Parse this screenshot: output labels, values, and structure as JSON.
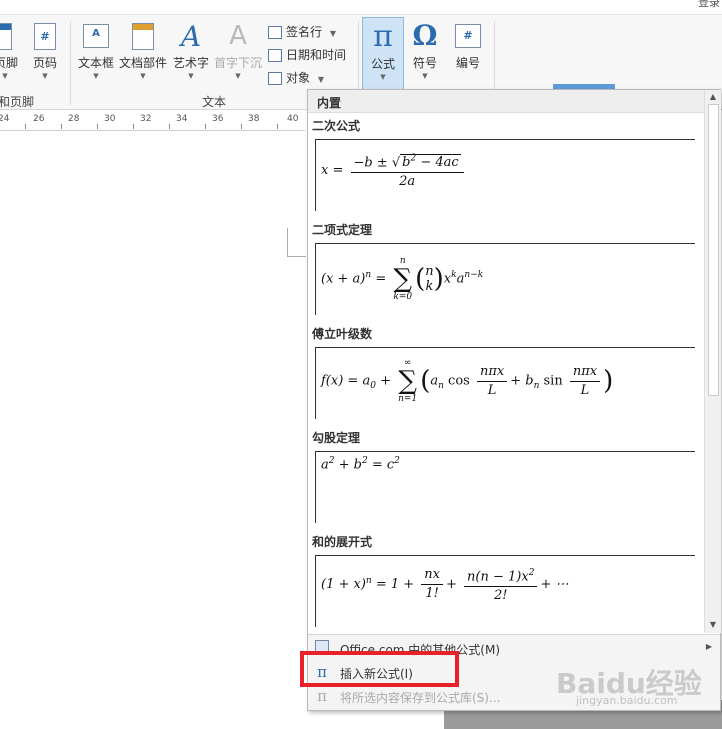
{
  "topbar": {
    "login_text": "登录"
  },
  "ribbon": {
    "partial_header_footer_label": "页脚",
    "page_number_label": "页码",
    "textbox_label": "文本框",
    "doc_parts_label": "文档部件",
    "wordart_label": "艺术字",
    "dropcap_label": "首字下沉",
    "signature_line_label": "签名行",
    "datetime_label": "日期和时间",
    "object_label": "对象",
    "formula_label": "公式",
    "symbol_label": "符号",
    "numbering_label": "编号",
    "group_header_footer": "和页脚",
    "group_text": "文本"
  },
  "ruler": {
    "ticks": [
      "24",
      "26",
      "28",
      "30",
      "32",
      "34",
      "36",
      "38",
      "40"
    ]
  },
  "panel": {
    "header": "内置",
    "sections": [
      {
        "title": "二次公式"
      },
      {
        "title": "二项式定理"
      },
      {
        "title": "傅立叶级数"
      },
      {
        "title": "勾股定理"
      },
      {
        "title": "和的展开式"
      }
    ],
    "menu": {
      "more_formulas": "Office.com 中的其他公式(M)",
      "insert_new": "插入新公式(I)",
      "save_selection": "将所选内容保存到公式库(S)..."
    }
  },
  "watermark": {
    "brand": "Baidu经验",
    "url": "jingyan.baidu.com"
  }
}
